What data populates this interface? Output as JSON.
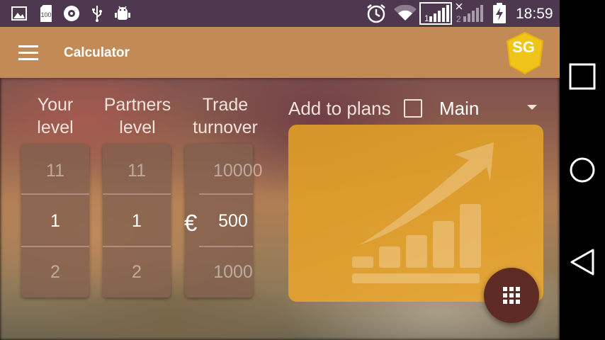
{
  "status_bar": {
    "time": "18:59",
    "left_icons": [
      "image-icon",
      "storage-100-icon",
      "shield-icon",
      "usb-icon",
      "android-debug-icon"
    ],
    "right_icons": [
      "alarm-icon",
      "wifi-icon",
      "sim1-signal-icon",
      "sim2-signal-icon",
      "battery-charging-icon"
    ],
    "sim1_label": "1",
    "sim2_label": "2",
    "storage_label": "100"
  },
  "app_bar": {
    "title": "Calculator",
    "logo_text": "SG"
  },
  "pickers": [
    {
      "label_line1": "Your",
      "label_line2": "level",
      "prev": "11",
      "value": "1",
      "next": "2"
    },
    {
      "label_line1": "Partners",
      "label_line2": "level",
      "prev": "11",
      "value": "1",
      "next": "2"
    },
    {
      "label_line1": "Trade",
      "label_line2": "turnover",
      "prev": "10000",
      "value": "500",
      "next": "1000"
    }
  ],
  "currency_symbol": "€",
  "plans": {
    "label": "Add to plans",
    "checked": false,
    "selected": "Main"
  },
  "colors": {
    "status_bar": "#4e3850",
    "app_bar": "#c28a57",
    "card": "#e0a030",
    "fab": "#5e2a24"
  }
}
